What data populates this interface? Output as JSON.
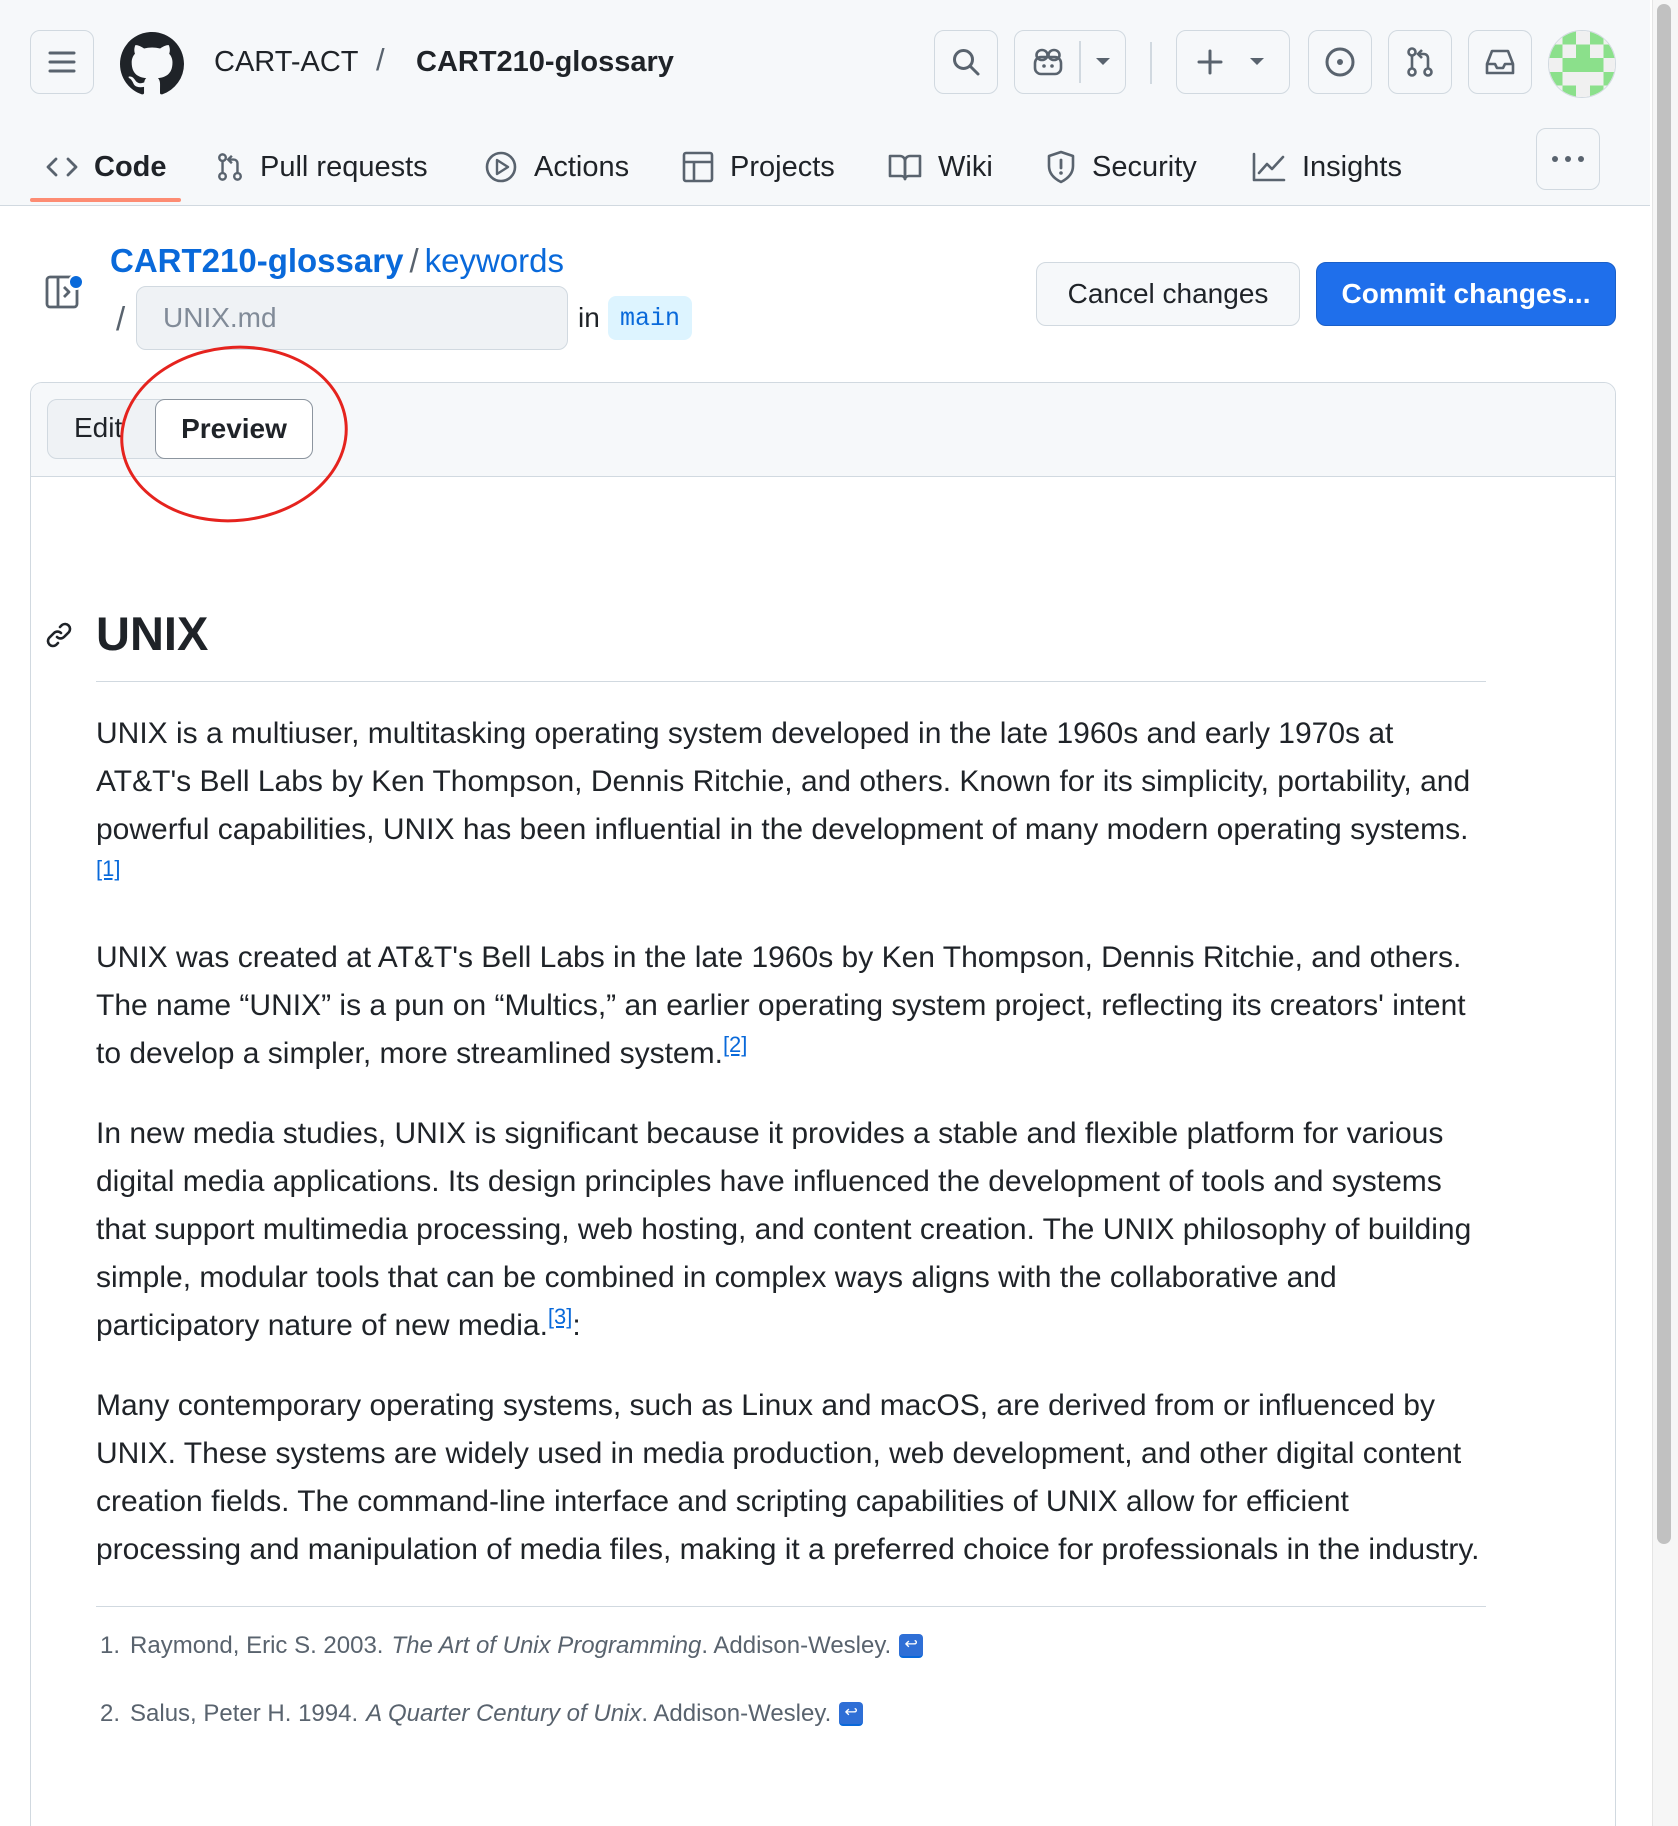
{
  "header": {
    "owner": "CART-ACT",
    "separator": "/",
    "repo": "CART210-glossary"
  },
  "tabs": [
    {
      "label": "Code",
      "icon": "code-icon"
    },
    {
      "label": "Pull requests",
      "icon": "git-pull-request-icon"
    },
    {
      "label": "Actions",
      "icon": "play-circle-icon"
    },
    {
      "label": "Projects",
      "icon": "table-icon"
    },
    {
      "label": "Wiki",
      "icon": "book-icon"
    },
    {
      "label": "Security",
      "icon": "shield-icon"
    },
    {
      "label": "Insights",
      "icon": "graph-icon"
    }
  ],
  "file": {
    "repo_link": "CART210-glossary",
    "folder_link": "keywords",
    "slash": "/",
    "filename_placeholder": "UNIX.md",
    "in_label": "in",
    "branch": "main"
  },
  "actions": {
    "cancel": "Cancel changes",
    "commit": "Commit changes..."
  },
  "editor": {
    "tab_edit": "Edit",
    "tab_preview": "Preview"
  },
  "content": {
    "heading": "UNIX",
    "p1": "UNIX is a multiuser, multitasking operating system developed in the late 1960s and early 1970s at AT&T's Bell Labs by Ken Thompson, Dennis Ritchie, and others. Known for its simplicity, portability, and powerful capabilities, UNIX has been influential in the development of many modern operating systems.",
    "p1_ref": "[1]",
    "p2": "UNIX was created at AT&T's Bell Labs in the late 1960s by Ken Thompson, Dennis Ritchie, and others. The name “UNIX” is a pun on “Multics,” an earlier operating system project, reflecting its creators' intent to develop a simpler, more streamlined system.",
    "p2_ref": "[2]",
    "p3": "In new media studies, UNIX is significant because it provides a stable and flexible platform for various digital media applications. Its design principles have influenced the development of tools and systems that support multimedia processing, web hosting, and content creation. The UNIX philosophy of building simple, modular tools that can be combined in complex ways aligns with the collaborative and participatory nature of new media.",
    "p3_ref": "[3]",
    "p3_tail": ":",
    "p4": "Many contemporary operating systems, such as Linux and macOS, are derived from or influenced by UNIX. These systems are widely used in media production, web development, and other digital content creation fields. The command-line interface and scripting capabilities of UNIX allow for efficient processing and manipulation of media files, making it a preferred choice for professionals in the industry.",
    "footnotes": [
      {
        "num": "1.",
        "pre": "Raymond, Eric S. 2003.",
        "title": "The Art of Unix Programming",
        "post": ". Addison-Wesley."
      },
      {
        "num": "2.",
        "pre": "Salus, Peter H. 1994.",
        "title": "A Quarter Century of Unix",
        "post": ". Addison-Wesley."
      }
    ]
  },
  "colors": {
    "accent": "#0969da",
    "commit_button": "#1f6feb",
    "annotation": "#e5231e",
    "tab_underline": "#fd8c73"
  }
}
